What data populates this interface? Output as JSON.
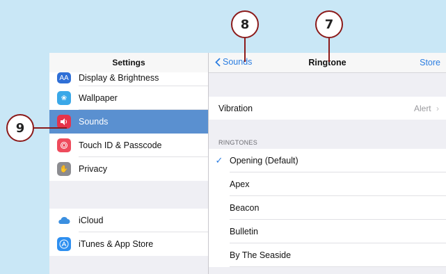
{
  "left_panel": {
    "title": "Settings",
    "group1": [
      {
        "label": "Display & Brightness",
        "icon": "display-brightness-icon",
        "color": "#2f6fd6"
      },
      {
        "label": "Wallpaper",
        "icon": "wallpaper-icon",
        "color": "#3aa8e8"
      },
      {
        "label": "Sounds",
        "icon": "sounds-icon",
        "color": "#e6334a",
        "selected": true
      },
      {
        "label": "Touch ID & Passcode",
        "icon": "touch-id-icon",
        "color": "#ee4b5c"
      },
      {
        "label": "Privacy",
        "icon": "privacy-hand-icon",
        "color": "#8c8c90"
      }
    ],
    "group2": [
      {
        "label": "iCloud",
        "icon": "icloud-icon",
        "color": "#3b8fe0"
      },
      {
        "label": "iTunes & App Store",
        "icon": "app-store-icon",
        "color": "#2e8ff0"
      }
    ]
  },
  "nav": {
    "back_label": "Sounds",
    "title": "Ringtone",
    "right_label": "Store"
  },
  "vibration": {
    "label": "Vibration",
    "value": "Alert"
  },
  "ringtones": {
    "header": "RINGTONES",
    "items": [
      {
        "label": "Opening (Default)",
        "checked": true
      },
      {
        "label": "Apex",
        "checked": false
      },
      {
        "label": "Beacon",
        "checked": false
      },
      {
        "label": "Bulletin",
        "checked": false
      },
      {
        "label": "By The Seaside",
        "checked": false
      }
    ]
  },
  "callouts": {
    "eight": "8",
    "seven": "7",
    "nine": "9"
  },
  "colors": {
    "accent": "#2a7de1",
    "selected_row": "#5a90d0",
    "callout_border": "#8b1a1a",
    "background": "#c9e7f6"
  }
}
